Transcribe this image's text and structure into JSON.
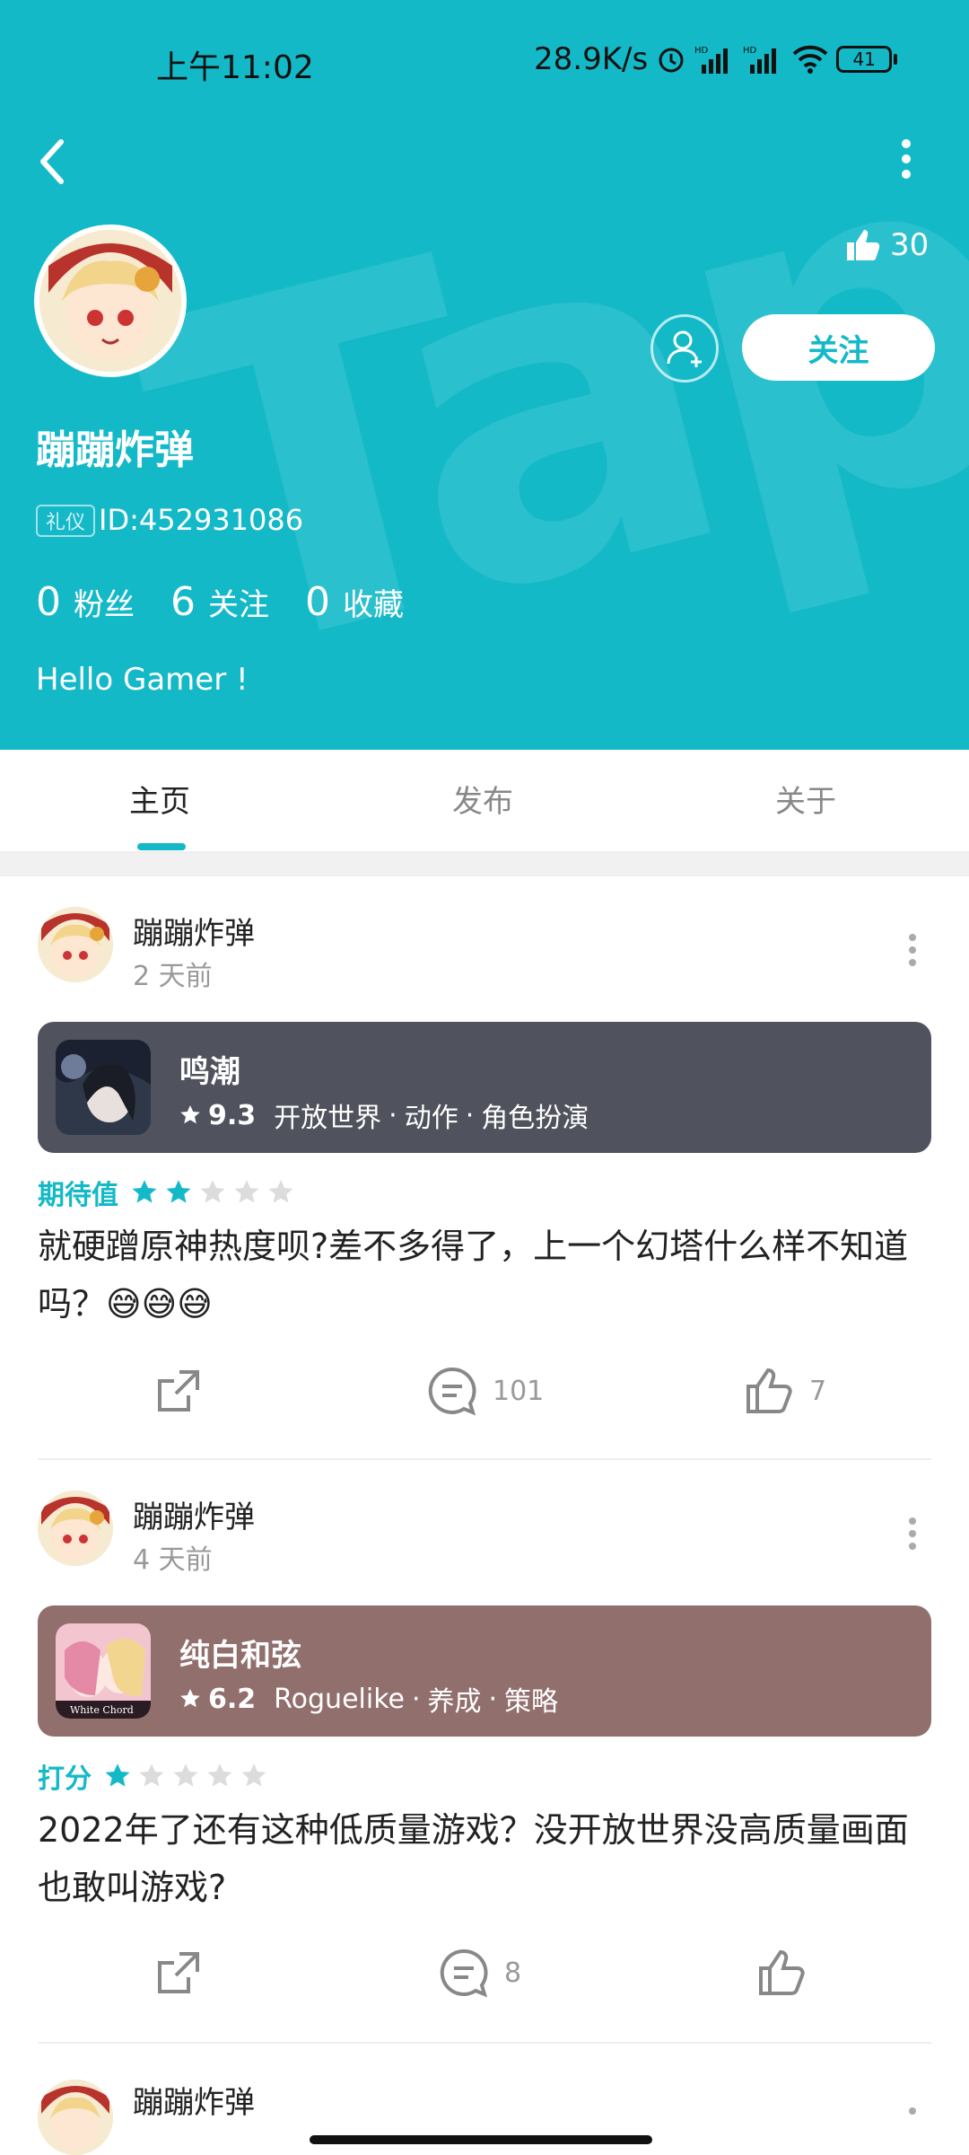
{
  "status_bar": {
    "time": "上午11:02",
    "net_speed": "28.9K/s",
    "battery": "41"
  },
  "profile": {
    "username": "蹦蹦炸弹",
    "badge": "礼仪",
    "id_text": "ID:452931086",
    "likes": "30",
    "follow_label": "关注",
    "bio": "Hello Gamer !",
    "stats": [
      {
        "num": "0",
        "label": "粉丝"
      },
      {
        "num": "6",
        "label": "关注"
      },
      {
        "num": "0",
        "label": "收藏"
      }
    ]
  },
  "tabs": [
    "主页",
    "发布",
    "关于"
  ],
  "active_tab": "主页",
  "posts": [
    {
      "author": "蹦蹦炸弹",
      "time": "2 天前",
      "game": {
        "name": "鸣潮",
        "score": "9.3",
        "tags": [
          "开放世界",
          "动作",
          "角色扮演"
        ],
        "card_color": "#50535d"
      },
      "rating_label": "期待值",
      "stars": 2,
      "content": "就硬蹭原神热度呗?差不多得了，上一个幻塔什么样不知道吗？😅😅😅",
      "comments": "101",
      "likes": "7"
    },
    {
      "author": "蹦蹦炸弹",
      "time": "4 天前",
      "game": {
        "name": "纯白和弦",
        "score": "6.2",
        "tags": [
          "Roguelike",
          "养成",
          "策略"
        ],
        "card_color": "#916f6d"
      },
      "rating_label": "打分",
      "stars": 1,
      "content": "2022年了还有这种低质量游戏？没开放世界没高质量画面也敢叫游戏?",
      "comments": "8",
      "likes": ""
    },
    {
      "author": "蹦蹦炸弹"
    }
  ],
  "colors": {
    "accent": "#14b9c8"
  }
}
